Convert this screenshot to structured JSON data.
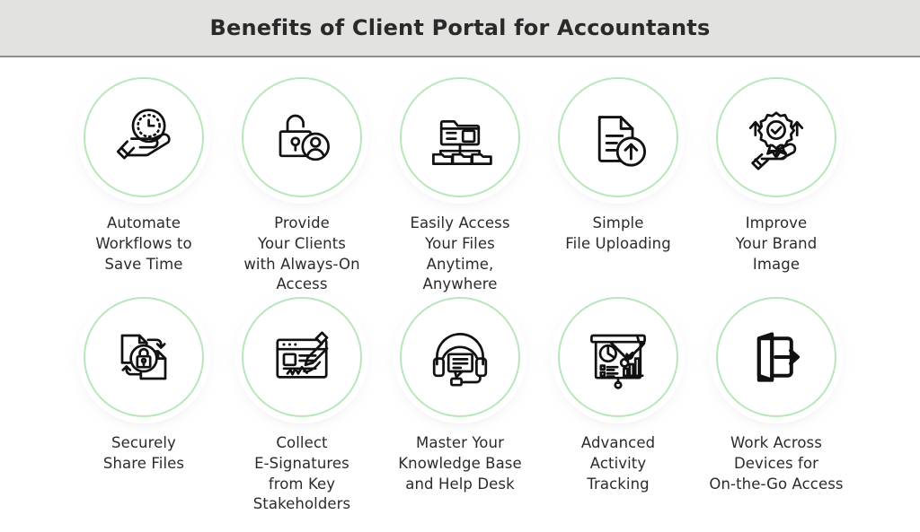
{
  "header": {
    "title": "Benefits of Client Portal for Accountants",
    "background_color": "#e2e2e0",
    "border_color": "#8e8e8e",
    "title_color": "#2a2a2a"
  },
  "theme": {
    "ring_color": "#b9e6bb",
    "page_background": "#ffffff",
    "icon_stroke_color": "#111111",
    "text_color": "#2b2b2b"
  },
  "benefits": [
    {
      "id": "automate-workflows",
      "icon": "hand-holding-clock-icon",
      "label": "Automate\nWorkflows to\nSave Time"
    },
    {
      "id": "always-on-access",
      "icon": "unlocked-padlock-user-icon",
      "label": "Provide\nYour Clients\nwith Always-On\nAccess"
    },
    {
      "id": "easily-access-files",
      "icon": "folder-hierarchy-icon",
      "label": "Easily Access\nYour Files\nAnytime,\nAnywhere"
    },
    {
      "id": "simple-file-uploading",
      "icon": "document-upload-icon",
      "label": "Simple\nFile Uploading"
    },
    {
      "id": "improve-brand-image",
      "icon": "hand-holding-award-badge-icon",
      "label": "Improve\nYour Brand\nImage"
    },
    {
      "id": "securely-share-files",
      "icon": "documents-sync-lock-icon",
      "label": "Securely\nShare Files"
    },
    {
      "id": "collect-e-signatures",
      "icon": "browser-signature-pen-icon",
      "label": "Collect\nE-Signatures\nfrom Key\nStakeholders"
    },
    {
      "id": "knowledge-base-help-desk",
      "icon": "headset-chat-support-icon",
      "label": "Master Your\nKnowledge Base\nand Help Desk"
    },
    {
      "id": "advanced-activity-tracking",
      "icon": "presentation-charts-tools-icon",
      "label": "Advanced\nActivity\nTracking"
    },
    {
      "id": "work-across-devices",
      "icon": "door-exit-arrow-icon",
      "label": "Work Across\nDevices for\nOn-the-Go Access"
    }
  ]
}
